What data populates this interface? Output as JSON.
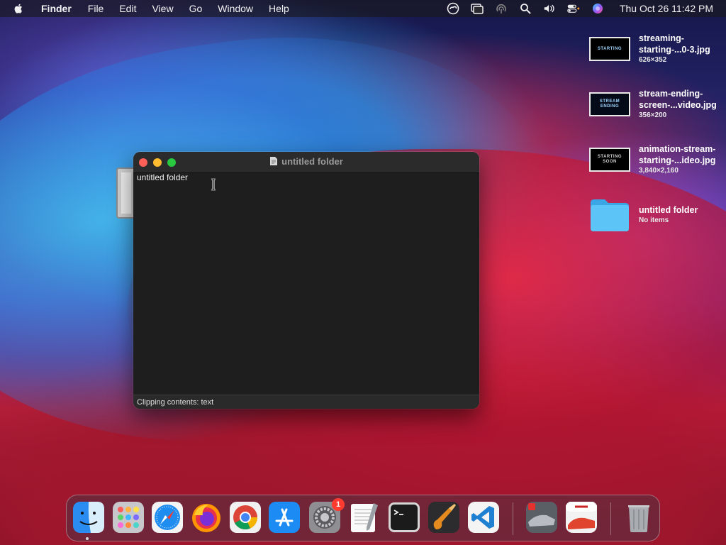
{
  "menubar": {
    "app_name": "Finder",
    "menus": [
      "File",
      "Edit",
      "View",
      "Go",
      "Window",
      "Help"
    ],
    "status_icons": [
      "creative-cloud-icon",
      "screen-mirroring-icon",
      "airdrop-icon",
      "search-icon",
      "volume-icon",
      "control-center-icon",
      "siri-icon"
    ],
    "datetime": "Thu Oct 26  11:42 PM"
  },
  "desktop_items": [
    {
      "name_line1": "streaming-",
      "name_line2": "starting-...0-3.jpg",
      "sub": "626×352",
      "thumb_text": "STARTING"
    },
    {
      "name_line1": "stream-ending-",
      "name_line2": "screen-...video.jpg",
      "sub": "356×200",
      "thumb_text": "STREAM ENDING"
    },
    {
      "name_line1": "animation-stream-",
      "name_line2": "starting-...ideo.jpg",
      "sub": "3,840×2,160",
      "thumb_text": "STARTING SOON"
    },
    {
      "name_line1": "untitled folder",
      "sub": "No items"
    }
  ],
  "window": {
    "title": "untitled folder",
    "content": "untitled folder",
    "status": "Clipping contents: text"
  },
  "dock": {
    "apps": [
      {
        "name": "Finder",
        "icon": "finder-icon"
      },
      {
        "name": "Launchpad",
        "icon": "launchpad-icon"
      },
      {
        "name": "Safari",
        "icon": "safari-icon"
      },
      {
        "name": "Firefox",
        "icon": "firefox-icon"
      },
      {
        "name": "Chrome",
        "icon": "chrome-icon"
      },
      {
        "name": "App Store",
        "icon": "app-store-icon"
      },
      {
        "name": "System Preferences",
        "icon": "system-preferences-icon",
        "badge": "1"
      },
      {
        "name": "TextEdit",
        "icon": "textedit-icon"
      },
      {
        "name": "Terminal",
        "icon": "terminal-icon"
      },
      {
        "name": "GarageBand",
        "icon": "garageband-icon"
      },
      {
        "name": "Visual Studio Code",
        "icon": "vscode-icon"
      },
      {
        "name": "Asphalt 8",
        "icon": "asphalt8-icon"
      },
      {
        "name": "Asphalt 9",
        "icon": "asphalt9-icon"
      },
      {
        "name": "Trash",
        "icon": "trash-icon"
      }
    ]
  },
  "colors": {
    "window_bg": "#1e1e1e",
    "close": "#fe5f57",
    "minimize": "#febc2e",
    "maximize": "#28c840",
    "folder_blue": "#4ab7f0",
    "badge_red": "#ff3b30"
  }
}
